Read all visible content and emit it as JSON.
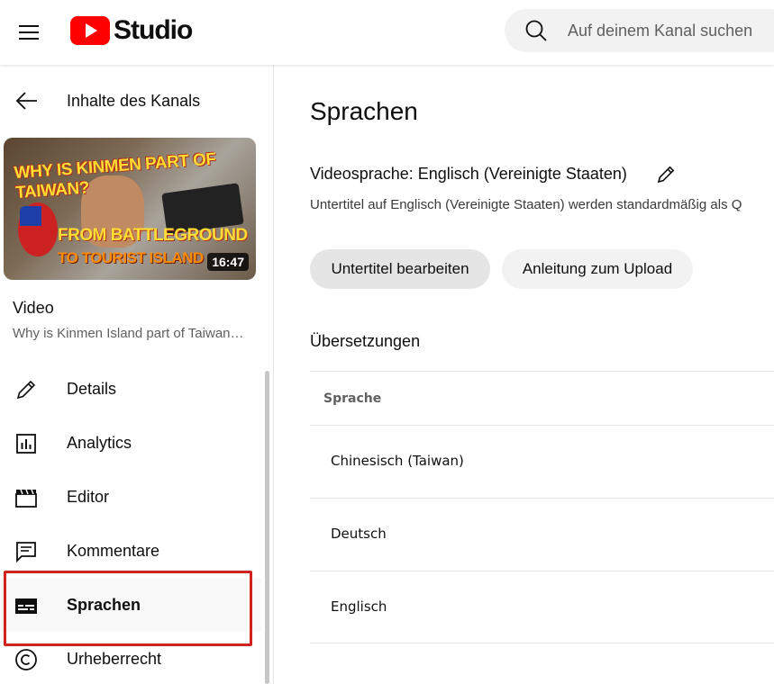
{
  "header": {
    "logo_text": "Studio",
    "search_placeholder": "Auf deinem Kanal suchen"
  },
  "sidebar": {
    "back_label": "Inhalte des Kanals",
    "thumbnail": {
      "line1": "WHY IS KINMEN PART OF TAIWAN?",
      "line2": "FROM BATTLEGROUND",
      "line3": "TO TOURIST ISLAND",
      "duration": "16:47"
    },
    "video_heading": "Video",
    "video_title": "Why is Kinmen Island part of Taiwan…",
    "nav": [
      {
        "label": "Details",
        "icon": "pencil-icon"
      },
      {
        "label": "Analytics",
        "icon": "analytics-icon"
      },
      {
        "label": "Editor",
        "icon": "clapperboard-icon"
      },
      {
        "label": "Kommentare",
        "icon": "comment-icon"
      },
      {
        "label": "Sprachen",
        "icon": "subtitles-icon",
        "active": true
      },
      {
        "label": "Urheberrecht",
        "icon": "copyright-icon"
      }
    ]
  },
  "main": {
    "title": "Sprachen",
    "video_language": "Videosprache: Englisch (Vereinigte Staaten)",
    "subtitle_info": "Untertitel auf Englisch (Vereinigte Staaten) werden standardmäßig als Q",
    "buttons": {
      "edit_subtitles": "Untertitel bearbeiten",
      "upload_guide": "Anleitung zum Upload"
    },
    "translations_title": "Übersetzungen",
    "table": {
      "header": "Sprache",
      "rows": [
        "Chinesisch (Taiwan)",
        "Deutsch",
        "Englisch"
      ]
    }
  },
  "colors": {
    "brand_red": "#ff0000",
    "highlight_red": "#d0231d"
  }
}
